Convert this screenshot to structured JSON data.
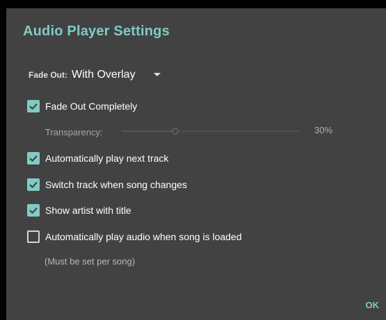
{
  "dialog": {
    "title": "Audio Player Settings",
    "accent_color": "#80cbc4",
    "background_color": "#424242"
  },
  "fade_out": {
    "label": "Fade Out:",
    "selected": "With Overlay"
  },
  "fade_out_completely": {
    "label": "Fade Out Completely",
    "checked": true
  },
  "transparency": {
    "label": "Transparency:",
    "value_text": "30%",
    "value": 0.3
  },
  "options": [
    {
      "label": "Automatically play next track",
      "checked": true
    },
    {
      "label": "Switch track when song changes",
      "checked": true
    },
    {
      "label": "Show artist with title",
      "checked": true
    },
    {
      "label": "Automatically play audio when song is loaded",
      "checked": false
    }
  ],
  "note": "(Must be set per song)",
  "ok_label": "OK"
}
